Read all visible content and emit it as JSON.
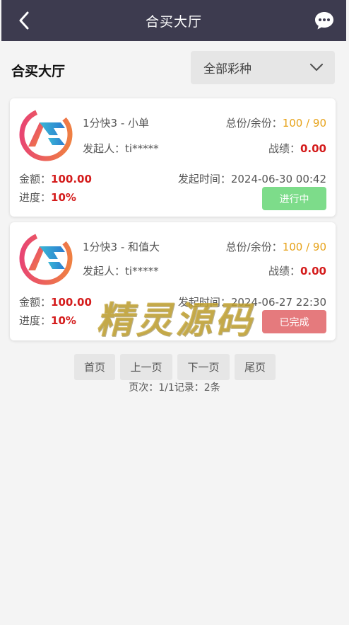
{
  "header": {
    "title": "合买大厅"
  },
  "section": {
    "title": "合买大厅",
    "filter_value": "全部彩种"
  },
  "colors": {
    "header_bg": "#3d3b4f",
    "red": "#d41c1c",
    "orange": "#e7a31b",
    "in_progress": "#7ddc8a",
    "completed": "#e57a7d"
  },
  "cards": [
    {
      "game": "1分快3 - 小单",
      "total_label": "总份/余份：",
      "total_value": "100 / 90",
      "initiator_label": "发起人：",
      "initiator": "ti*****",
      "record_label": "战绩：",
      "record": "0.00",
      "amount_label": "金额：",
      "amount": "100.00",
      "time_label": "发起时间：",
      "time": "2024-06-30 00:42",
      "progress_label": "进度：",
      "progress": "10%",
      "status": "进行中"
    },
    {
      "game": "1分快3 - 和值大",
      "total_label": "总份/余份：",
      "total_value": "100 / 90",
      "initiator_label": "发起人：",
      "initiator": "ti*****",
      "record_label": "战绩：",
      "record": "0.00",
      "amount_label": "金额：",
      "amount": "100.00",
      "time_label": "发起时间：",
      "time": "2024-06-27 22:30",
      "progress_label": "进度：",
      "progress": "10%",
      "status": "已完成"
    }
  ],
  "pagination": {
    "first": "首页",
    "prev": "上一页",
    "next": "下一页",
    "last": "尾页",
    "info": "页次：1/1记录：2条"
  },
  "watermark": "精灵源码"
}
